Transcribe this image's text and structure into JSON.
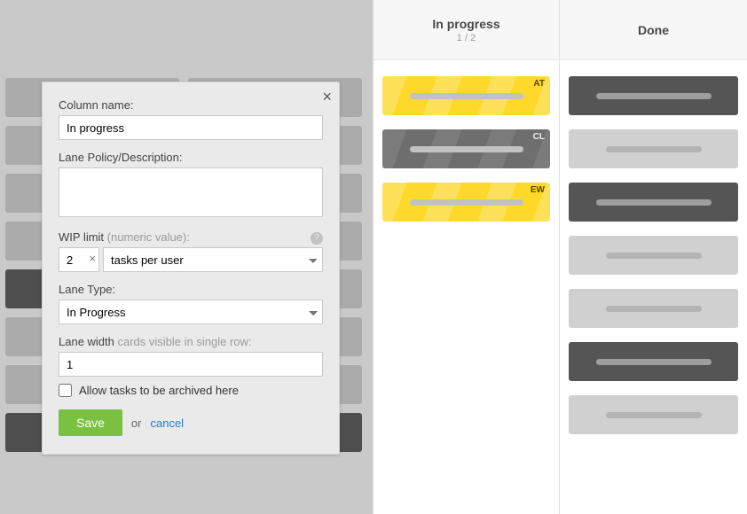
{
  "modal": {
    "column_name_label": "Column name:",
    "column_name_value": "In progress",
    "lane_policy_label": "Lane Policy/Description:",
    "lane_policy_value": "",
    "wip_label": "WIP limit ",
    "wip_hint": "(numeric value):",
    "wip_value": "2",
    "wip_unit_value": "tasks per user",
    "lane_type_label": "Lane Type:",
    "lane_type_value": "In Progress",
    "lane_width_label": "Lane width ",
    "lane_width_hint": "cards visible in single row:",
    "lane_width_value": "1",
    "allow_archive_label": "Allow tasks to be archived here",
    "allow_archive_checked": false,
    "save_label": "Save",
    "or_label": "or",
    "cancel_label": "cancel"
  },
  "columns": {
    "inprogress": {
      "title": "In progress",
      "sub": "1 / 2",
      "cards": [
        {
          "badge": "AT",
          "style": "yellow"
        },
        {
          "badge": "CL",
          "style": "greycard"
        },
        {
          "badge": "EW",
          "style": "yellow"
        }
      ]
    },
    "done": {
      "title": "Done",
      "cards": [
        {
          "style": "darkfill"
        },
        {
          "style": "lightfill"
        },
        {
          "style": "darkfill"
        },
        {
          "style": "lightfill"
        },
        {
          "style": "lightfill"
        },
        {
          "style": "darkfill"
        },
        {
          "style": "lightfill"
        }
      ]
    }
  }
}
